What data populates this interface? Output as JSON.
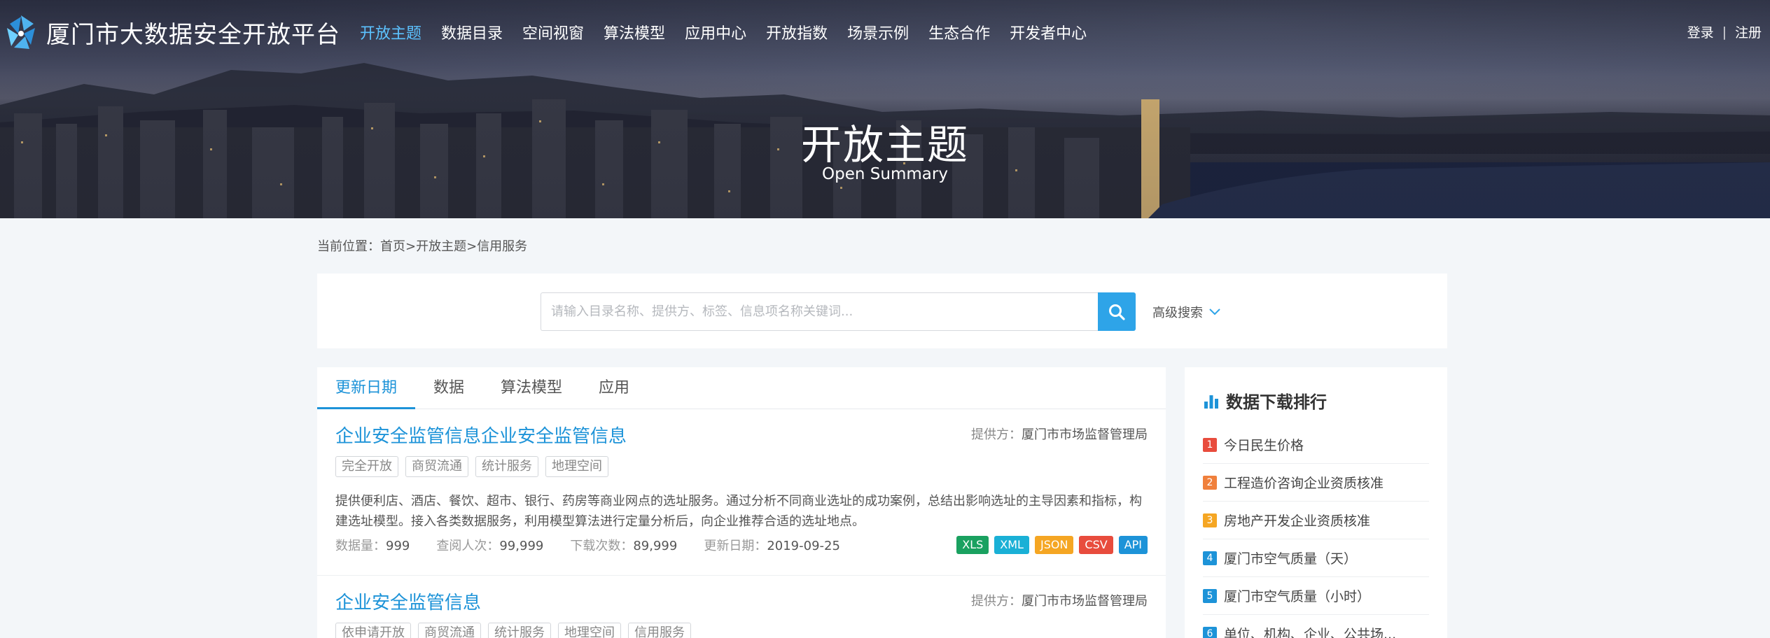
{
  "header": {
    "site_title": "厦门市大数据安全开放平台",
    "nav": [
      {
        "label": "开放主题",
        "active": true
      },
      {
        "label": "数据目录",
        "active": false
      },
      {
        "label": "空间视窗",
        "active": false
      },
      {
        "label": "算法模型",
        "active": false
      },
      {
        "label": "应用中心",
        "active": false
      },
      {
        "label": "开放指数",
        "active": false
      },
      {
        "label": "场景示例",
        "active": false
      },
      {
        "label": "生态合作",
        "active": false
      },
      {
        "label": "开发者中心",
        "active": false
      }
    ],
    "login_label": "登录",
    "auth_separator": "|",
    "register_label": "注册",
    "accent_color": "#5cc2ff"
  },
  "banner": {
    "title": "开放主题",
    "subtitle": "Open Summary"
  },
  "breadcrumb": {
    "prefix": "当前位置：",
    "home": "首页",
    "sep": ">",
    "level1": "开放主题",
    "level2": "信用服务"
  },
  "search": {
    "placeholder": "请输入目录名称、提供方、标签、信息项名称关键词...",
    "value": "",
    "button_icon": "search-icon",
    "advanced_label": "高级搜索",
    "button_color": "#2ea4e8"
  },
  "tabs": [
    {
      "label": "更新日期",
      "active": true
    },
    {
      "label": "数据",
      "active": false
    },
    {
      "label": "算法模型",
      "active": false
    },
    {
      "label": "应用",
      "active": false
    }
  ],
  "results": [
    {
      "title": "企业安全监管信息企业安全监管信息",
      "provider_label": "提供方：",
      "provider": "厦门市市场监督管理局",
      "tags": [
        "完全开放",
        "商贸流通",
        "统计服务",
        "地理空间"
      ],
      "description": "提供便利店、酒店、餐饮、超市、银行、药房等商业网点的选址服务。通过分析不同商业选址的成功案例，总结出影响选址的主导因素和指标，构建选址模型。接入各类数据服务，利用模型算法进行定量分析后，向企业推荐合适的选址地点。",
      "meta": [
        {
          "label": "数据量：",
          "value": "999"
        },
        {
          "label": "查阅人次：",
          "value": "99,999"
        },
        {
          "label": "下载次数：",
          "value": "89,999"
        },
        {
          "label": "更新日期：",
          "value": "2019-09-25"
        }
      ],
      "formats": [
        {
          "label": "XLS",
          "color": "#1aa160"
        },
        {
          "label": "XML",
          "color": "#1ab0d6"
        },
        {
          "label": "JSON",
          "color": "#f5a623"
        },
        {
          "label": "CSV",
          "color": "#e84c3d"
        },
        {
          "label": "API",
          "color": "#1d93d8"
        }
      ]
    },
    {
      "title": "企业安全监管信息",
      "provider_label": "提供方：",
      "provider": "厦门市市场监督管理局",
      "tags": [
        "依申请开放",
        "商贸流通",
        "统计服务",
        "地理空间",
        "信用服务"
      ]
    }
  ],
  "ranking": {
    "title": "数据下载排行",
    "icon": "bar-chart-icon",
    "items": [
      {
        "rank": "1",
        "label": "今日民生价格",
        "color": "#e84c3d"
      },
      {
        "rank": "2",
        "label": "工程造价咨询企业资质核准",
        "color": "#f0803c"
      },
      {
        "rank": "3",
        "label": "房地产开发企业资质核准",
        "color": "#f5a623"
      },
      {
        "rank": "4",
        "label": "厦门市空气质量（天）",
        "color": "#1d93d8"
      },
      {
        "rank": "5",
        "label": "厦门市空气质量（小时）",
        "color": "#1d93d8"
      },
      {
        "rank": "6",
        "label": "单位、机构、企业、公共场...",
        "color": "#1d93d8"
      }
    ]
  }
}
